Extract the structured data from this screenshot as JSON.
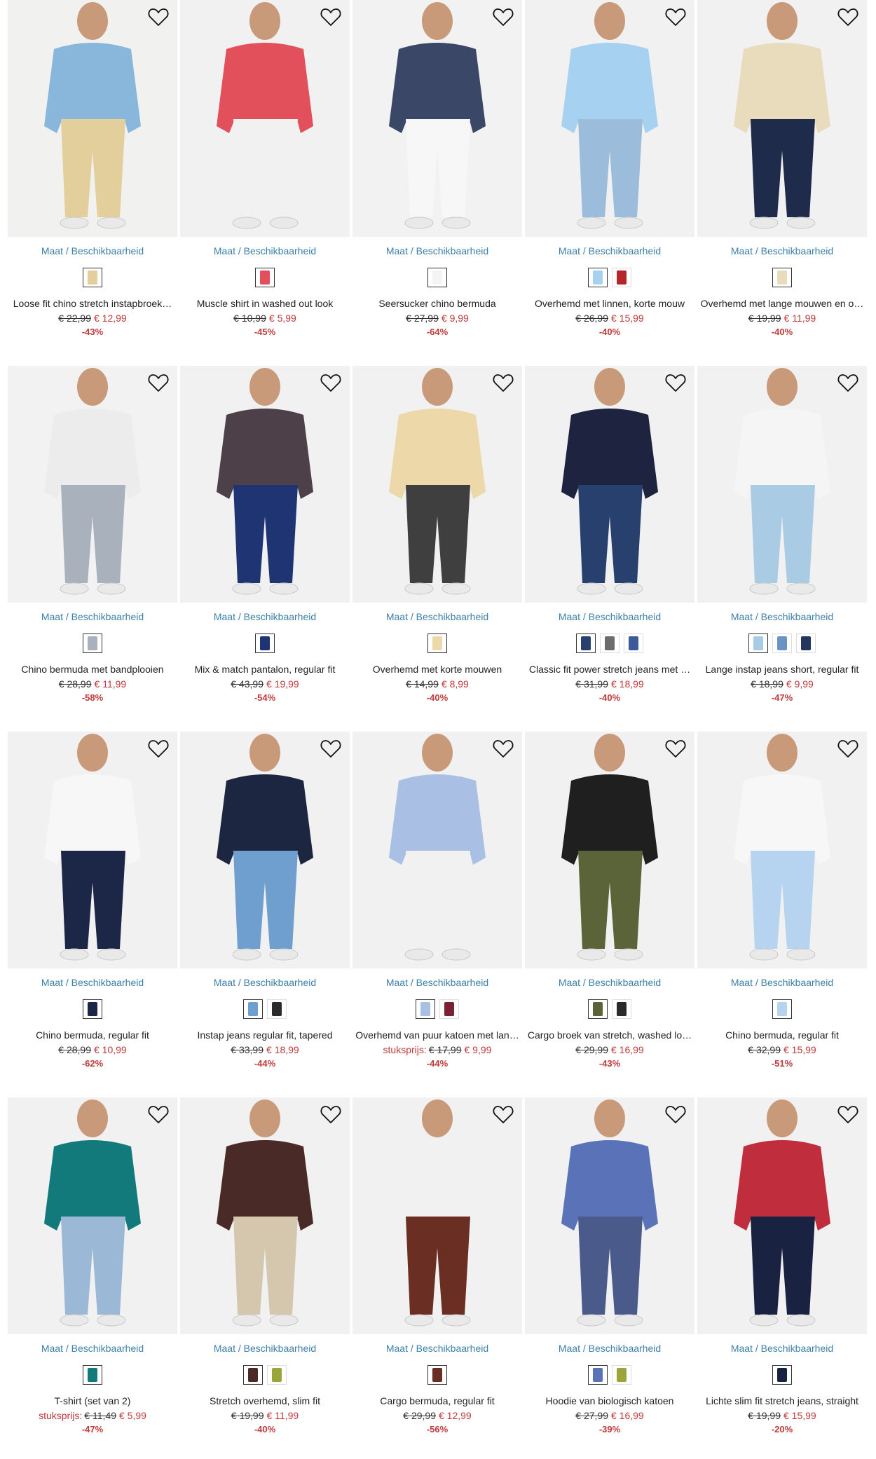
{
  "labels": {
    "size_availability": "Maat / Beschikbaarheid"
  },
  "icons": {
    "favorite": "heart-outline-icon"
  },
  "colors": {
    "link": "#3c7fa8",
    "sale": "#c0393b"
  },
  "products": [
    {
      "title": "Loose fit chino stretch instapbroek…",
      "old": "€ 22,99",
      "new": "€ 12,99",
      "discount": "-43%",
      "prefix": "",
      "bg": "#f1f1f0",
      "top": "#88b7db",
      "bottom": "#e3cf9c",
      "swatches": [
        "#e3cf9c"
      ]
    },
    {
      "title": "Muscle shirt in washed out look",
      "old": "€ 10,99",
      "new": "€ 5,99",
      "discount": "-45%",
      "prefix": "",
      "bg": "#f1f1f1",
      "top": "#e2505c",
      "bottom": "#f1f1f1",
      "swatches": [
        "#e2505c"
      ]
    },
    {
      "title": "Seersucker chino bermuda",
      "old": "€ 27,99",
      "new": "€ 9,99",
      "discount": "-64%",
      "prefix": "",
      "bg": "#f2f2f2",
      "top": "#3b4766",
      "bottom": "#f7f7f7",
      "swatches": [
        "#f4f4f4"
      ]
    },
    {
      "title": "Overhemd met linnen, korte mouw",
      "old": "€ 26,99",
      "new": "€ 15,99",
      "discount": "-40%",
      "prefix": "",
      "bg": "#f1f1f1",
      "top": "#a6d1f1",
      "bottom": "#9cbcdc",
      "swatches": [
        "#a6d1f1",
        "#b5262a"
      ]
    },
    {
      "title": "Overhemd met lange mouwen en o…",
      "old": "€ 19,99",
      "new": "€ 11,99",
      "discount": "-40%",
      "prefix": "",
      "bg": "#f1f1f1",
      "top": "#e8dcbc",
      "bottom": "#1e2b4a",
      "swatches": [
        "#e8dcbc"
      ]
    },
    {
      "title": "Chino bermuda met bandplooien",
      "old": "€ 28,99",
      "new": "€ 11,99",
      "discount": "-58%",
      "prefix": "",
      "bg": "#f2f2f2",
      "top": "#ececec",
      "bottom": "#a9b1bd",
      "swatches": [
        "#a9b1bd"
      ]
    },
    {
      "title": "Mix & match pantalon, regular fit",
      "old": "€ 43,99",
      "new": "€ 19,99",
      "discount": "-54%",
      "prefix": "",
      "bg": "#f1f1f1",
      "top": "#4e4048",
      "bottom": "#1f3573",
      "swatches": [
        "#1f3573"
      ]
    },
    {
      "title": "Overhemd met korte mouwen",
      "old": "€ 14,99",
      "new": "€ 8,99",
      "discount": "-40%",
      "prefix": "",
      "bg": "#f1f1f1",
      "top": "#ecd8a8",
      "bottom": "#3f3f3f",
      "swatches": [
        "#ecd8a8"
      ]
    },
    {
      "title": "Classic fit power stretch jeans met …",
      "old": "€ 31,99",
      "new": "€ 18,99",
      "discount": "-40%",
      "prefix": "",
      "bg": "#f1f1f1",
      "top": "#1e2340",
      "bottom": "#28406e",
      "swatches": [
        "#28406e",
        "#6c6c6c",
        "#3b5c96"
      ]
    },
    {
      "title": "Lange instap jeans short, regular fit",
      "old": "€ 18,99",
      "new": "€ 9,99",
      "discount": "-47%",
      "prefix": "",
      "bg": "#f1f1f1",
      "top": "#f5f5f5",
      "bottom": "#a9cbe3",
      "swatches": [
        "#a9cbe3",
        "#6a93c3",
        "#23355f"
      ]
    },
    {
      "title": "Chino bermuda, regular fit",
      "old": "€ 28,99",
      "new": "€ 10,99",
      "discount": "-62%",
      "prefix": "",
      "bg": "#f1f1f1",
      "top": "#f7f7f7",
      "bottom": "#1c2747",
      "swatches": [
        "#1c2747"
      ]
    },
    {
      "title": "Instap jeans regular fit, tapered",
      "old": "€ 33,99",
      "new": "€ 18,99",
      "discount": "-44%",
      "prefix": "",
      "bg": "#f1f1f1",
      "top": "#1d2640",
      "bottom": "#6f9fcf",
      "swatches": [
        "#6f9fcf",
        "#2a2a2a"
      ]
    },
    {
      "title": "Overhemd van puur katoen met lan…",
      "old": "€ 17,99",
      "new": "€ 9,99",
      "discount": "-44%",
      "prefix": "stuksprijs:",
      "bg": "#f1f1f1",
      "top": "#a9bfe3",
      "bottom": "#f1f1f1",
      "swatches": [
        "#a9bfe3",
        "#7a2233"
      ]
    },
    {
      "title": "Cargo broek van stretch, washed lo…",
      "old": "€ 29,99",
      "new": "€ 16,99",
      "discount": "-43%",
      "prefix": "",
      "bg": "#f1f1f1",
      "top": "#1f1f1f",
      "bottom": "#5a6438",
      "swatches": [
        "#5a6438",
        "#2a2a2a"
      ]
    },
    {
      "title": "Chino bermuda, regular fit",
      "old": "€ 32,99",
      "new": "€ 15,99",
      "discount": "-51%",
      "prefix": "",
      "bg": "#f1f1f1",
      "top": "#f7f7f7",
      "bottom": "#b6d3ef",
      "swatches": [
        "#b6d3ef"
      ]
    },
    {
      "title": "T-shirt (set van 2)",
      "old": "€ 11,49",
      "new": "€ 5,99",
      "discount": "-47%",
      "prefix": "stuksprijs:",
      "bg": "#f1f1f1",
      "top": "#137a7c",
      "bottom": "#9bb9d6",
      "swatches": [
        "#137a7c"
      ]
    },
    {
      "title": "Stretch overhemd, slim fit",
      "old": "€ 19,99",
      "new": "€ 11,99",
      "discount": "-40%",
      "prefix": "",
      "bg": "#f1f1f1",
      "top": "#4a2a26",
      "bottom": "#d4c7ae",
      "swatches": [
        "#4a2a26",
        "#9aa63a"
      ]
    },
    {
      "title": "Cargo bermuda, regular fit",
      "old": "€ 29,99",
      "new": "€ 12,99",
      "discount": "-56%",
      "prefix": "",
      "bg": "#f1f1f1",
      "top": "#f1f1f1",
      "bottom": "#6a2e23",
      "swatches": [
        "#6a2e23"
      ]
    },
    {
      "title": "Hoodie van biologisch katoen",
      "old": "€ 27,99",
      "new": "€ 16,99",
      "discount": "-39%",
      "prefix": "",
      "bg": "#f1f1f1",
      "top": "#5a73b8",
      "bottom": "#4a5a8a",
      "swatches": [
        "#5a73b8",
        "#9aa63a"
      ]
    },
    {
      "title": "Lichte slim fit stretch jeans, straight",
      "old": "€ 19,99",
      "new": "€ 15,99",
      "discount": "-20%",
      "prefix": "",
      "bg": "#f1f1f1",
      "top": "#c02d3c",
      "bottom": "#1a2242",
      "swatches": [
        "#1a2242"
      ]
    }
  ]
}
